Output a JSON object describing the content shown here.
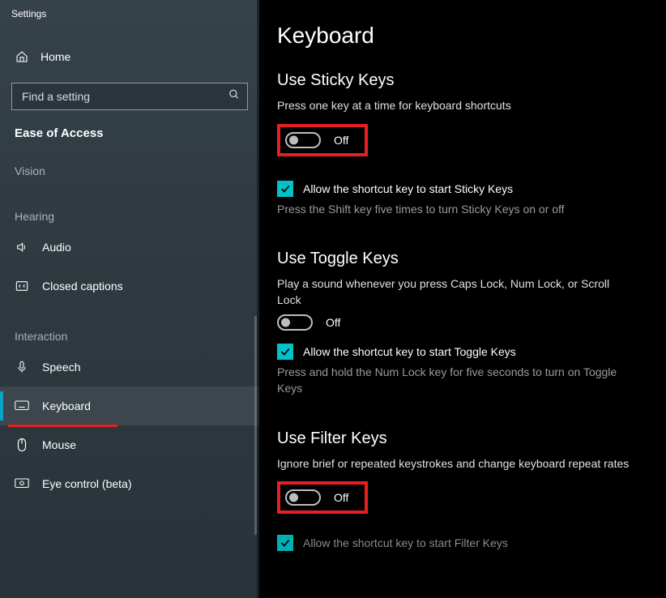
{
  "app_title": "Settings",
  "sidebar": {
    "home_label": "Home",
    "search_placeholder": "Find a setting",
    "section_title": "Ease of Access",
    "groups": {
      "vision": "Vision",
      "hearing": "Hearing",
      "interaction": "Interaction"
    },
    "items": {
      "audio": "Audio",
      "closed_captions": "Closed captions",
      "speech": "Speech",
      "keyboard": "Keyboard",
      "mouse": "Mouse",
      "eye_control": "Eye control (beta)"
    }
  },
  "main": {
    "title": "Keyboard",
    "sticky": {
      "heading": "Use Sticky Keys",
      "desc": "Press one key at a time for keyboard shortcuts",
      "toggle_state": "Off",
      "check_label": "Allow the shortcut key to start Sticky Keys",
      "hint": "Press the Shift key five times to turn Sticky Keys on or off"
    },
    "toggle_keys": {
      "heading": "Use Toggle Keys",
      "desc": "Play a sound whenever you press Caps Lock, Num Lock, or Scroll Lock",
      "toggle_state": "Off",
      "check_label": "Allow the shortcut key to start Toggle Keys",
      "hint": "Press and hold the Num Lock key for five seconds to turn on Toggle Keys"
    },
    "filter": {
      "heading": "Use Filter Keys",
      "desc": "Ignore brief or repeated keystrokes and change keyboard repeat rates",
      "toggle_state": "Off",
      "check_label_partial": "Allow the shortcut key to start Filter Keys"
    }
  }
}
